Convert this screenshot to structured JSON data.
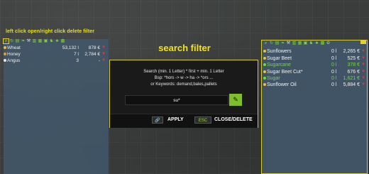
{
  "captions": {
    "left": "left click open/right click delete filter",
    "center": "search filter"
  },
  "left_panel": {
    "items": [
      {
        "name": "Wheat",
        "qty": "53,132 l",
        "price": "878 €",
        "icon": "wheat-icon"
      },
      {
        "name": "Honey",
        "qty": "7 l",
        "price": "2,784 €",
        "icon": "honey-icon"
      },
      {
        "name": "Angus",
        "qty": "3",
        "price": "-",
        "icon": "cow-icon"
      }
    ]
  },
  "right_panel": {
    "items": [
      {
        "name": "Sunflowers",
        "qty": "0 l",
        "price": "2,265 €",
        "highlight": false
      },
      {
        "name": "Sugar Beet",
        "qty": "0 l",
        "price": "525 €",
        "highlight": false
      },
      {
        "name": "Sugarcane",
        "qty": "0 l",
        "price": "378 €",
        "highlight": true
      },
      {
        "name": "Sugar Beet Cut*",
        "qty": "0 l",
        "price": "676 €",
        "highlight": false
      },
      {
        "name": "Sugar",
        "qty": "0 l",
        "price": "1,621 €",
        "highlight": true
      },
      {
        "name": "Sunflower Oil",
        "qty": "0 l",
        "price": "5,884 €",
        "highlight": false
      }
    ]
  },
  "dialog": {
    "line1": "Search (min. 1 Letter) * first + min. 1 Letter",
    "line2": "Bsp: *hors -> w -> ha -> *ors ...",
    "line3": "or Keywords: demand,bales,pallets",
    "search_value": "su*",
    "apply_label": "APPLY",
    "apply_key": "🔗",
    "esc_key": "ESC",
    "close_label": "CLOSE/DELETE"
  },
  "colors": {
    "accent_yellow": "#e8e020",
    "highlight_green": "#6edc3a",
    "down_arrow_red": "#e23a3a",
    "panel_blue": "#42586c"
  }
}
